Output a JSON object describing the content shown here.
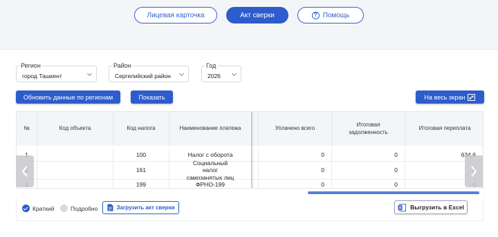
{
  "nav": {
    "card_label": "Лицевая карточка",
    "act_label": "Акт сверки",
    "help_label": "Помощь"
  },
  "filters": {
    "region": {
      "label": "Регион",
      "value": "город Ташкент"
    },
    "district": {
      "label": "Район",
      "value": "Сергелийский район"
    },
    "year": {
      "label": "Год",
      "value": "2026"
    }
  },
  "actions": {
    "refresh_label": "Обновить данные по регионам",
    "show_label": "Показать",
    "fullscreen_label": "На весь экран"
  },
  "table": {
    "columns": {
      "num": "№",
      "object_code": "Код объекта",
      "tax_code": "Код налога",
      "payment_name": "Наименование платежа",
      "paid_total": "Уплачено всего",
      "final_debt": "Итоговая задолженность",
      "final_overpay": "Итоговая переплата"
    },
    "rows": [
      {
        "num": "1",
        "object_code": "",
        "tax_code": "100",
        "payment_name": "Налог с оборота",
        "paid_total": "0",
        "final_debt": "0",
        "final_overpay": "634,6"
      },
      {
        "num": "2",
        "object_code": "",
        "tax_code": "161",
        "payment_name": "Социальный налог самозанятых лиц",
        "paid_total": "0",
        "final_debt": "0",
        "final_overpay": "0"
      },
      {
        "num": "3",
        "object_code": "",
        "tax_code": "199",
        "payment_name": "ФРНО-199",
        "paid_total": "0",
        "final_debt": "0",
        "final_overpay": "0"
      }
    ]
  },
  "footer": {
    "brief_label": "Краткий",
    "detailed_label": "Подробно",
    "load_act_label": "Загрузить акт сверки",
    "excel_label": "Выгрузить в Excel"
  },
  "colors": {
    "accent": "#2d5ccc",
    "header_bg": "#f4f5f7"
  }
}
